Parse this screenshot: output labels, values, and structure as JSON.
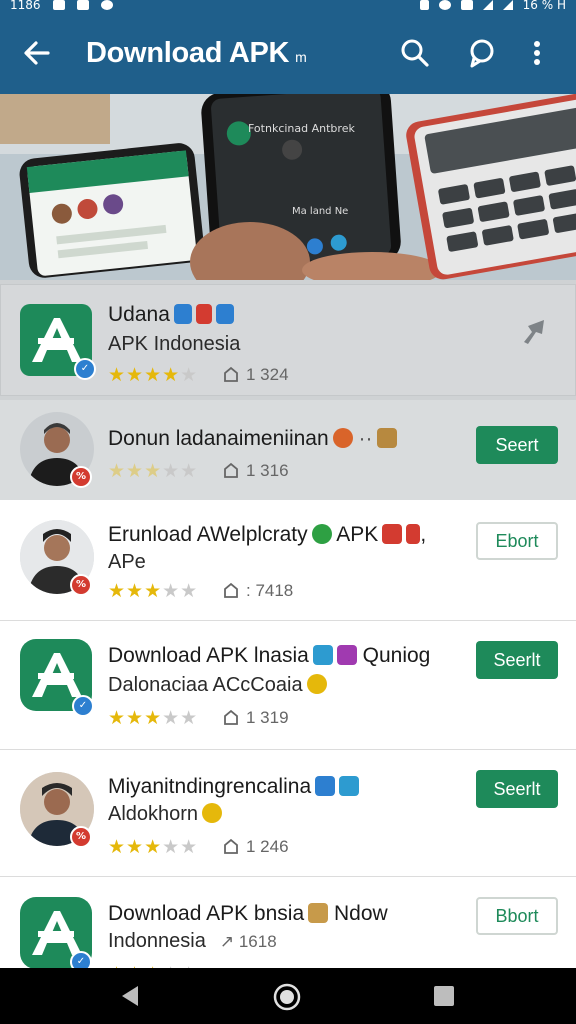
{
  "status_bar": {
    "left_time": "1186",
    "right_time": "16 % H"
  },
  "app_bar": {
    "title": "Download APK",
    "title_tail": "m"
  },
  "featured": {
    "name": "Udana",
    "subtitle": "APK Indonesia",
    "rating": 4,
    "count": "1 324"
  },
  "apps": [
    {
      "name": "Donun ladanaimeniinan",
      "rating": 3,
      "count": "1 316",
      "button": "Seert",
      "button_style": "filled",
      "badge": "%"
    },
    {
      "name": "Erunload AWelplcraty",
      "name_suffix": "APK",
      "subtitle": "APe",
      "rating": 3,
      "count": ": 7418",
      "button": "Ebort",
      "button_style": "outline",
      "badge": "%"
    },
    {
      "name": "Download APK lnasia",
      "name_suffix": "Quniog",
      "subtitle": "Dalonaciaa ACcCoaia",
      "rating": 3,
      "count": "1 319",
      "button": "Seerlt",
      "button_style": "filled",
      "badge": "✓"
    },
    {
      "name": "Miyanitndingrencalina",
      "subtitle": "Aldokhorn",
      "rating": 3,
      "count": "1 246",
      "button": "Seerlt",
      "button_style": "filled",
      "badge": "%"
    },
    {
      "name": "Download APK bnsia",
      "name_suffix": "Ndow",
      "subtitle": "Indonnesia",
      "count": "1618",
      "button": "Bbort",
      "button_style": "outline",
      "badge": "✓"
    }
  ],
  "hero": {
    "phone_title": "Fotnkcinad Antbrek",
    "phone_text": "Ma land Ne"
  },
  "colors": {
    "primary": "#1f5f8b",
    "accent_green": "#1e8a5a",
    "star": "#e5b80b"
  }
}
